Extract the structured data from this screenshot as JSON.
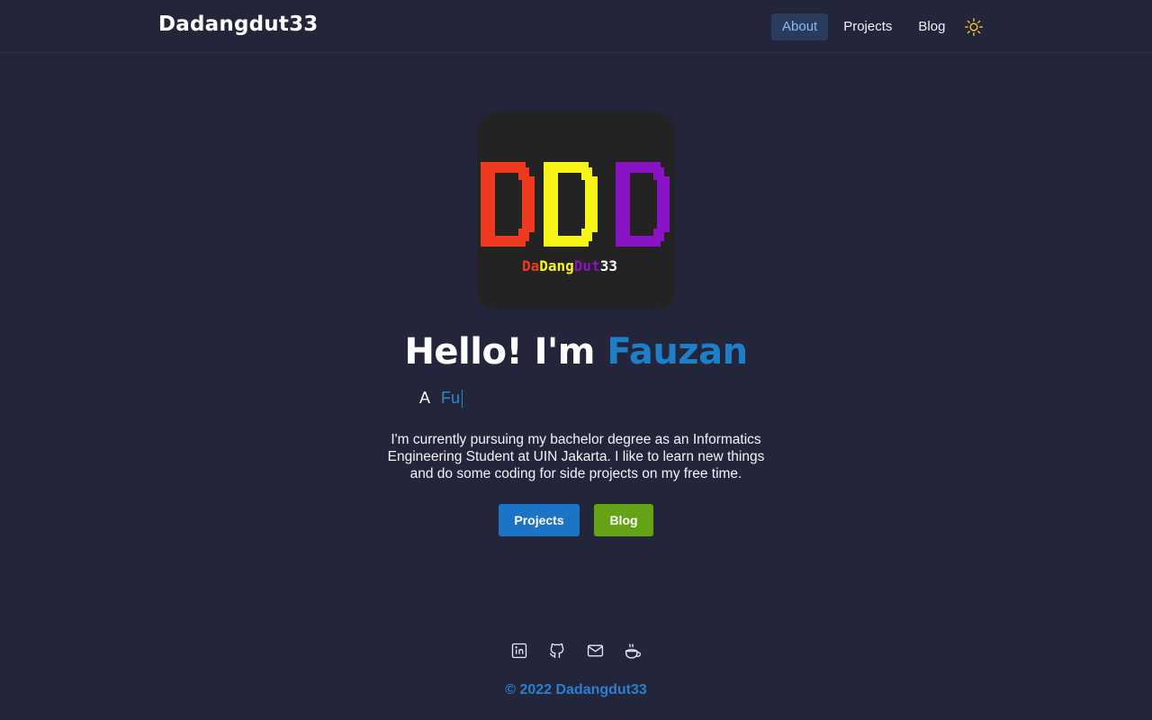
{
  "header": {
    "brand": "Dadangdut33",
    "nav": [
      {
        "label": "About",
        "active": true
      },
      {
        "label": "Projects",
        "active": false
      },
      {
        "label": "Blog",
        "active": false
      }
    ],
    "theme_icon": "sun-icon"
  },
  "avatar": {
    "big_letters": "DDD",
    "caption_parts": [
      "Da",
      "Dang",
      "Dut",
      "33"
    ],
    "colors": {
      "red": "#f03a1f",
      "yellow": "#f7f517",
      "purple": "#8a13c4",
      "white": "#ffffff"
    }
  },
  "hero": {
    "greeting": "Hello! I'm ",
    "name": "Fauzan",
    "typing_prefix": "A",
    "typing_text": "Fu",
    "bio": "I'm currently pursuing my bachelor degree as an Informatics Engineering Student at UIN Jakarta. I like to learn new things and do some coding for side projects on my free time."
  },
  "buttons": {
    "projects": "Projects",
    "blog": "Blog"
  },
  "socials": [
    "linkedin-icon",
    "github-icon",
    "mail-icon",
    "coffee-icon"
  ],
  "footer": {
    "copyright": "© 2022 Dadangdut33"
  },
  "colors": {
    "background": "#23263a",
    "accent_blue": "#1e7fc7",
    "button_green": "#64a315",
    "active_nav_bg": "#2a3c5e"
  }
}
